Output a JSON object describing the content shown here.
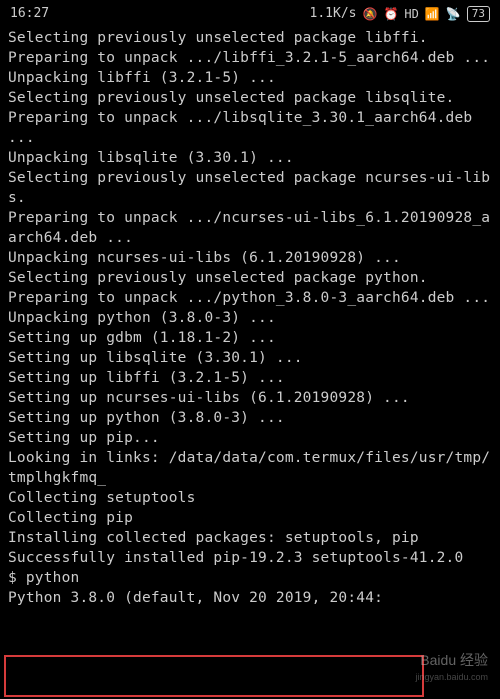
{
  "status": {
    "time": "16:27",
    "net_speed": "1.1K/s",
    "battery": "73"
  },
  "lines": [
    "Selecting previously unselected package libffi.",
    "Preparing to unpack .../libffi_3.2.1-5_aarch64.deb ...",
    "Unpacking libffi (3.2.1-5) ...",
    "Selecting previously unselected package libsqlite.",
    "Preparing to unpack .../libsqlite_3.30.1_aarch64.deb ...",
    "Unpacking libsqlite (3.30.1) ...",
    "Selecting previously unselected package ncurses-ui-libs.",
    "Preparing to unpack .../ncurses-ui-libs_6.1.20190928_aarch64.deb ...",
    "Unpacking ncurses-ui-libs (6.1.20190928) ...",
    "Selecting previously unselected package python.",
    "Preparing to unpack .../python_3.8.0-3_aarch64.deb ...",
    "Unpacking python (3.8.0-3) ...",
    "Setting up gdbm (1.18.1-2) ...",
    "Setting up libsqlite (3.30.1) ...",
    "Setting up libffi (3.2.1-5) ...",
    "Setting up ncurses-ui-libs (6.1.20190928) ...",
    "Setting up python (3.8.0-3) ...",
    "Setting up pip...",
    "Looking in links: /data/data/com.termux/files/usr/tmp/tmplhgkfmq_",
    "Collecting setuptools",
    "Collecting pip",
    "Installing collected packages: setuptools, pip",
    "Successfully installed pip-19.2.3 setuptools-41.2.0",
    "$ python",
    "Python 3.8.0 (default, Nov 20 2019, 20:44:"
  ],
  "watermark": {
    "main": "Baidu 经验",
    "sub": "jingyan.baidu.com"
  }
}
